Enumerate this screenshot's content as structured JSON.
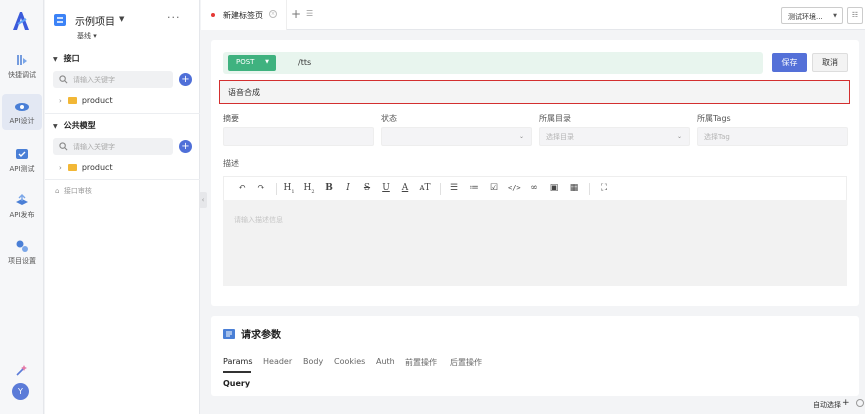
{
  "rail": {
    "items": [
      {
        "label": "快捷调试",
        "icon": "quick-debug-icon"
      },
      {
        "label": "API设计",
        "icon": "api-design-icon",
        "active": true
      },
      {
        "label": "API测试",
        "icon": "api-test-icon"
      },
      {
        "label": "API发布",
        "icon": "api-publish-icon"
      },
      {
        "label": "项目设置",
        "icon": "project-settings-icon"
      }
    ],
    "avatar_letter": "Y"
  },
  "project": {
    "name": "示例项目",
    "branch": "基线 ▾",
    "more": "···"
  },
  "tree": {
    "interfaces_title": "接口",
    "interfaces_search_placeholder": "请输入关键字",
    "interfaces_folder": "product",
    "models_title": "公共模型",
    "models_search_placeholder": "请输入关键字",
    "models_folder": "product",
    "review_label": "接口审核"
  },
  "tabs": {
    "active_tab": "新建标签页",
    "add": "+",
    "env_select": "测试环境...",
    "colors": {
      "unsaved_dot": "#e53935"
    }
  },
  "request": {
    "method": "POST",
    "url": "/tts",
    "save_label": "保存",
    "cancel_label": "取消",
    "name": "语音合成",
    "colors": {
      "method_bg": "#3fb27f",
      "primary": "#5470d8",
      "highlight_border": "#d32f2f"
    }
  },
  "fields": {
    "summary_label": "摘要",
    "status_label": "状态",
    "directory_label": "所属目录",
    "directory_placeholder": "选择目录",
    "tags_label": "所属Tags",
    "tags_placeholder": "选择Tag"
  },
  "description": {
    "label": "描述",
    "placeholder": "请输入描述信息",
    "toolbar": [
      "undo-icon",
      "redo-icon",
      "heading-1-icon",
      "heading-2-icon",
      "bold-icon",
      "italic-icon",
      "strikethrough-icon",
      "underline-icon",
      "text-color-icon",
      "font-size-icon",
      "bullet-list-icon",
      "numbered-list-icon",
      "task-list-icon",
      "code-icon",
      "link-icon",
      "image-icon",
      "table-icon",
      "fullscreen-icon"
    ]
  },
  "params": {
    "title": "请求参数",
    "tabs": [
      "Params",
      "Header",
      "Body",
      "Cookies",
      "Auth",
      "前置操作",
      "后置操作"
    ],
    "active_tab": "Params",
    "query_label": "Query"
  },
  "footer": {
    "auto_select": "自动选择",
    "plus": "+"
  }
}
